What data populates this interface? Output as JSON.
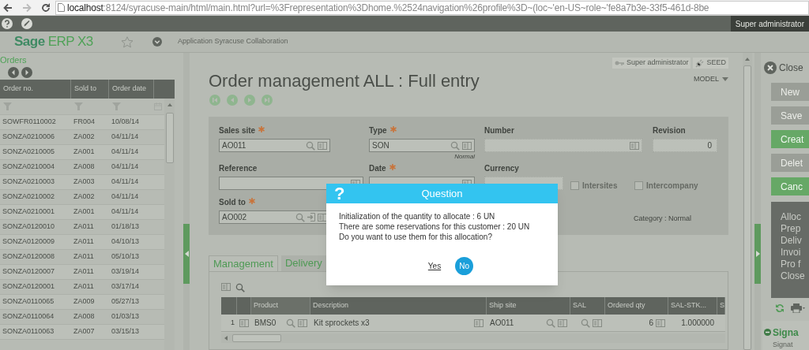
{
  "browser": {
    "host": "localhost",
    "path": ":8124/syracuse-main/html/main.html?url=%3Frepresentation%3Dhome.%2524navigation%26profile%3D~(loc~'en-US~role~'fe8a7b3e-33f5-461d-8be"
  },
  "top_bar": {
    "user": "Super administrator"
  },
  "header": {
    "logo_brand": "Sage",
    "logo_product": "ERP X3",
    "application": "Application Syracuse Collaboration"
  },
  "orders_panel": {
    "title": "Orders",
    "columns": [
      "Order no.",
      "Sold to",
      "Order date"
    ],
    "rows": [
      [
        "SOWFR0110002",
        "FR004",
        "10/08/14"
      ],
      [
        "SONZA0210006",
        "ZA002",
        "04/11/14"
      ],
      [
        "SONZA0210005",
        "ZA001",
        "04/11/14"
      ],
      [
        "SONZA0210004",
        "ZA008",
        "04/11/14"
      ],
      [
        "SONZA0210003",
        "ZA003",
        "04/11/14"
      ],
      [
        "SONZA0210002",
        "ZA002",
        "04/11/14"
      ],
      [
        "SONZA0210001",
        "ZA001",
        "04/11/14"
      ],
      [
        "SONZA0120010",
        "ZA011",
        "01/18/13"
      ],
      [
        "SONZA0120009",
        "ZA011",
        "04/10/13"
      ],
      [
        "SONZA0120008",
        "ZA011",
        "05/10/13"
      ],
      [
        "SONZA0120007",
        "ZA011",
        "03/19/14"
      ],
      [
        "SONZA0120001",
        "ZA011",
        "03/17/14"
      ],
      [
        "SONZA0110065",
        "ZA009",
        "05/27/13"
      ],
      [
        "SONZA0110064",
        "ZA008",
        "01/03/13"
      ],
      [
        "SONZA0110063",
        "ZA007",
        "03/15/13"
      ]
    ]
  },
  "page": {
    "badges": [
      {
        "kind": "user",
        "label": "Super administrator"
      },
      {
        "kind": "endpoint",
        "label": "SEED"
      }
    ],
    "title": "Order management ALL : Full entry",
    "model": "MODEL"
  },
  "form": {
    "fields": [
      {
        "kind": "input",
        "label": "Sales site",
        "required": true,
        "disabled": false,
        "value": "AO011",
        "lookup": true,
        "link": false,
        "detail": true
      },
      {
        "kind": "input",
        "label": "Type",
        "required": true,
        "disabled": false,
        "value": "SON",
        "hint": "Normal",
        "lookup": true,
        "link": false,
        "detail": true
      },
      {
        "kind": "input",
        "label": "Number",
        "required": false,
        "disabled": true,
        "lookup": false,
        "link": false,
        "detail": true
      },
      {
        "kind": "input",
        "label": "Revision",
        "required": false,
        "disabled": true,
        "value": "0",
        "lookup": false,
        "link": false,
        "detail": false
      },
      {
        "kind": "input",
        "label": "Reference",
        "required": false,
        "disabled": false,
        "lookup": false,
        "link": false,
        "detail": true
      },
      {
        "kind": "input",
        "label": "Date",
        "required": true,
        "disabled": false,
        "lookup": false,
        "link": false,
        "detail": true
      },
      {
        "kind": "input",
        "label": "Currency",
        "required": false,
        "disabled": true,
        "lookup": false,
        "link": false,
        "detail": false
      },
      {
        "kind": "checkbox",
        "label": "Intersites",
        "checked": false
      },
      {
        "kind": "checkbox",
        "label": "Intercompany",
        "checked": false
      },
      {
        "kind": "input",
        "label": "Sold to",
        "required": true,
        "disabled": false,
        "value": "AO002",
        "lookup": true,
        "link": true,
        "detail": true
      },
      {
        "kind": "text",
        "text": "Category : Normal"
      }
    ]
  },
  "tabs": [
    {
      "label": "Management",
      "selected": true
    },
    {
      "label": "Delivery",
      "selected": false
    }
  ],
  "lines": {
    "columns": [
      "Product",
      "Description",
      "Ship site",
      "SAL",
      "Ordered qty",
      "SAL-STK...",
      "S"
    ],
    "rows": [
      {
        "number": "1",
        "product": "BMS0",
        "description": "Kit sprockets x3",
        "ship_site": "AO011",
        "ordered_qty": "6",
        "sal_stk": "1.000000"
      }
    ]
  },
  "dialog": {
    "icon": "?",
    "title": "Question",
    "lines": [
      "Initialization of the quantity to allocate : 6 UN",
      "There are some reservations for this customer : 20 UN",
      "Do you want to use them for this allocation?"
    ],
    "buttons": [
      {
        "kind": "link",
        "label": "Yes"
      },
      {
        "kind": "primary",
        "label": "No"
      }
    ]
  },
  "actions_panel": {
    "close": "Close",
    "buttons": [
      {
        "label": "New",
        "disabled": true
      },
      {
        "label": "Save",
        "disabled": true
      },
      {
        "label": "Creat",
        "disabled": false
      },
      {
        "label": "Delet",
        "disabled": true
      },
      {
        "label": "Canc",
        "disabled": false
      }
    ],
    "menu": [
      "Alloc",
      "Prep",
      "Deliv",
      "Invoi",
      "Pro f",
      "Close"
    ],
    "section": {
      "title": "Signa",
      "subtitle": "Signat"
    }
  }
}
